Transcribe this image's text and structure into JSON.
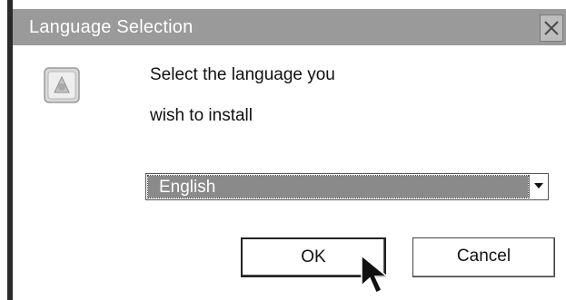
{
  "window": {
    "title": "Language Selection",
    "close_icon": "close-icon"
  },
  "message": {
    "line1": "Select the language you",
    "line2": "wish to install"
  },
  "language_select": {
    "selected_value": "English"
  },
  "buttons": {
    "ok_label": "OK",
    "cancel_label": "Cancel"
  },
  "icons": {
    "app": "installer-app-icon",
    "dropdown": "chevron-down-icon",
    "cursor": "mouse-pointer-icon"
  },
  "colors": {
    "titlebar_bg": "#9a9a9a",
    "title_text": "#ffffff",
    "selection_bg": "#8a8a8a",
    "window_bg": "#ffffff"
  }
}
